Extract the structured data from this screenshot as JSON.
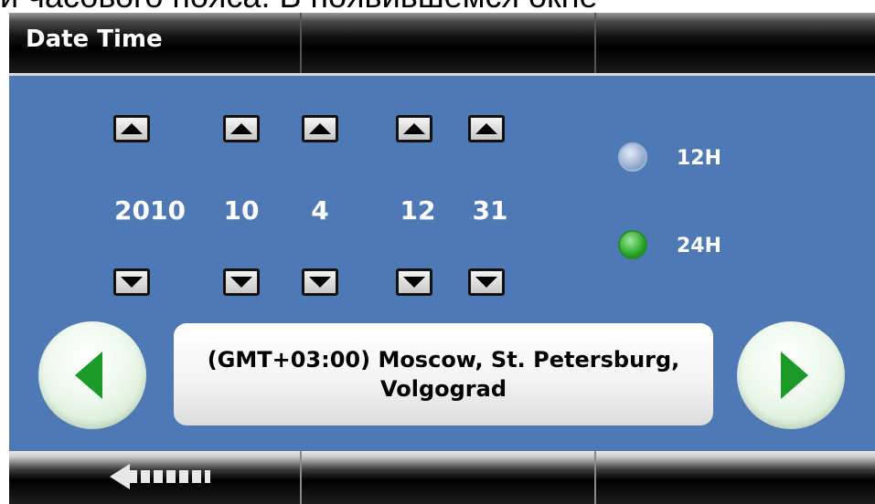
{
  "top_fragment": "и часового пояса. В появившемся окне",
  "title": "Date Time",
  "date_time": {
    "values": [
      "2010",
      "10",
      "4",
      "12",
      "31"
    ]
  },
  "clock_format": {
    "options": [
      "12H",
      "24H"
    ],
    "selected": "24H"
  },
  "timezone": {
    "line1": "(GMT+03:00) Moscow, St. Petersburg,",
    "line2": "Volgograd"
  },
  "colors": {
    "panel_bg": "#4f79b4",
    "accent_green": "#1b9a2a"
  },
  "icons": {
    "prev": "chevron-left-icon",
    "next": "chevron-right-icon",
    "back": "back-arrow-icon",
    "up": "triangle-up-icon",
    "down": "triangle-down-icon"
  }
}
